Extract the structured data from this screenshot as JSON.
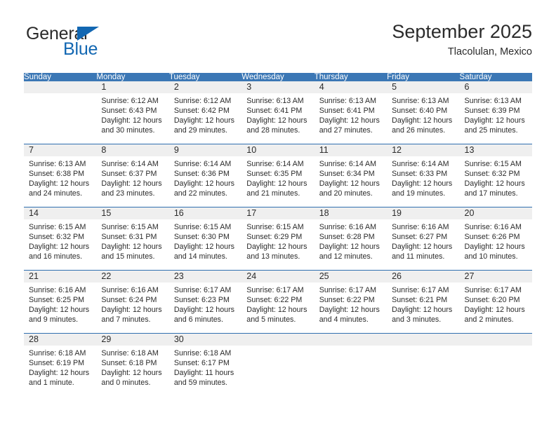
{
  "brand": {
    "name_top": "General",
    "name_bottom": "Blue",
    "accent_color": "#1267b2"
  },
  "header": {
    "title": "September 2025",
    "subtitle": "Tlacolulan, Mexico"
  },
  "theme": {
    "header_row_bg": "#3b77b5",
    "row_divider": "#2f6fb0",
    "daynum_band_bg": "#efefef",
    "text": "#2b2b2b"
  },
  "weekdays": [
    "Sunday",
    "Monday",
    "Tuesday",
    "Wednesday",
    "Thursday",
    "Friday",
    "Saturday"
  ],
  "weeks": [
    [
      {
        "day": "",
        "lines": []
      },
      {
        "day": "1",
        "lines": [
          "Sunrise: 6:12 AM",
          "Sunset: 6:43 PM",
          "Daylight: 12 hours",
          "and 30 minutes."
        ]
      },
      {
        "day": "2",
        "lines": [
          "Sunrise: 6:12 AM",
          "Sunset: 6:42 PM",
          "Daylight: 12 hours",
          "and 29 minutes."
        ]
      },
      {
        "day": "3",
        "lines": [
          "Sunrise: 6:13 AM",
          "Sunset: 6:41 PM",
          "Daylight: 12 hours",
          "and 28 minutes."
        ]
      },
      {
        "day": "4",
        "lines": [
          "Sunrise: 6:13 AM",
          "Sunset: 6:41 PM",
          "Daylight: 12 hours",
          "and 27 minutes."
        ]
      },
      {
        "day": "5",
        "lines": [
          "Sunrise: 6:13 AM",
          "Sunset: 6:40 PM",
          "Daylight: 12 hours",
          "and 26 minutes."
        ]
      },
      {
        "day": "6",
        "lines": [
          "Sunrise: 6:13 AM",
          "Sunset: 6:39 PM",
          "Daylight: 12 hours",
          "and 25 minutes."
        ]
      }
    ],
    [
      {
        "day": "7",
        "lines": [
          "Sunrise: 6:13 AM",
          "Sunset: 6:38 PM",
          "Daylight: 12 hours",
          "and 24 minutes."
        ]
      },
      {
        "day": "8",
        "lines": [
          "Sunrise: 6:14 AM",
          "Sunset: 6:37 PM",
          "Daylight: 12 hours",
          "and 23 minutes."
        ]
      },
      {
        "day": "9",
        "lines": [
          "Sunrise: 6:14 AM",
          "Sunset: 6:36 PM",
          "Daylight: 12 hours",
          "and 22 minutes."
        ]
      },
      {
        "day": "10",
        "lines": [
          "Sunrise: 6:14 AM",
          "Sunset: 6:35 PM",
          "Daylight: 12 hours",
          "and 21 minutes."
        ]
      },
      {
        "day": "11",
        "lines": [
          "Sunrise: 6:14 AM",
          "Sunset: 6:34 PM",
          "Daylight: 12 hours",
          "and 20 minutes."
        ]
      },
      {
        "day": "12",
        "lines": [
          "Sunrise: 6:14 AM",
          "Sunset: 6:33 PM",
          "Daylight: 12 hours",
          "and 19 minutes."
        ]
      },
      {
        "day": "13",
        "lines": [
          "Sunrise: 6:15 AM",
          "Sunset: 6:32 PM",
          "Daylight: 12 hours",
          "and 17 minutes."
        ]
      }
    ],
    [
      {
        "day": "14",
        "lines": [
          "Sunrise: 6:15 AM",
          "Sunset: 6:32 PM",
          "Daylight: 12 hours",
          "and 16 minutes."
        ]
      },
      {
        "day": "15",
        "lines": [
          "Sunrise: 6:15 AM",
          "Sunset: 6:31 PM",
          "Daylight: 12 hours",
          "and 15 minutes."
        ]
      },
      {
        "day": "16",
        "lines": [
          "Sunrise: 6:15 AM",
          "Sunset: 6:30 PM",
          "Daylight: 12 hours",
          "and 14 minutes."
        ]
      },
      {
        "day": "17",
        "lines": [
          "Sunrise: 6:15 AM",
          "Sunset: 6:29 PM",
          "Daylight: 12 hours",
          "and 13 minutes."
        ]
      },
      {
        "day": "18",
        "lines": [
          "Sunrise: 6:16 AM",
          "Sunset: 6:28 PM",
          "Daylight: 12 hours",
          "and 12 minutes."
        ]
      },
      {
        "day": "19",
        "lines": [
          "Sunrise: 6:16 AM",
          "Sunset: 6:27 PM",
          "Daylight: 12 hours",
          "and 11 minutes."
        ]
      },
      {
        "day": "20",
        "lines": [
          "Sunrise: 6:16 AM",
          "Sunset: 6:26 PM",
          "Daylight: 12 hours",
          "and 10 minutes."
        ]
      }
    ],
    [
      {
        "day": "21",
        "lines": [
          "Sunrise: 6:16 AM",
          "Sunset: 6:25 PM",
          "Daylight: 12 hours",
          "and 9 minutes."
        ]
      },
      {
        "day": "22",
        "lines": [
          "Sunrise: 6:16 AM",
          "Sunset: 6:24 PM",
          "Daylight: 12 hours",
          "and 7 minutes."
        ]
      },
      {
        "day": "23",
        "lines": [
          "Sunrise: 6:17 AM",
          "Sunset: 6:23 PM",
          "Daylight: 12 hours",
          "and 6 minutes."
        ]
      },
      {
        "day": "24",
        "lines": [
          "Sunrise: 6:17 AM",
          "Sunset: 6:22 PM",
          "Daylight: 12 hours",
          "and 5 minutes."
        ]
      },
      {
        "day": "25",
        "lines": [
          "Sunrise: 6:17 AM",
          "Sunset: 6:22 PM",
          "Daylight: 12 hours",
          "and 4 minutes."
        ]
      },
      {
        "day": "26",
        "lines": [
          "Sunrise: 6:17 AM",
          "Sunset: 6:21 PM",
          "Daylight: 12 hours",
          "and 3 minutes."
        ]
      },
      {
        "day": "27",
        "lines": [
          "Sunrise: 6:17 AM",
          "Sunset: 6:20 PM",
          "Daylight: 12 hours",
          "and 2 minutes."
        ]
      }
    ],
    [
      {
        "day": "28",
        "lines": [
          "Sunrise: 6:18 AM",
          "Sunset: 6:19 PM",
          "Daylight: 12 hours",
          "and 1 minute."
        ]
      },
      {
        "day": "29",
        "lines": [
          "Sunrise: 6:18 AM",
          "Sunset: 6:18 PM",
          "Daylight: 12 hours",
          "and 0 minutes."
        ]
      },
      {
        "day": "30",
        "lines": [
          "Sunrise: 6:18 AM",
          "Sunset: 6:17 PM",
          "Daylight: 11 hours",
          "and 59 minutes."
        ]
      },
      {
        "day": "",
        "lines": []
      },
      {
        "day": "",
        "lines": []
      },
      {
        "day": "",
        "lines": []
      },
      {
        "day": "",
        "lines": []
      }
    ]
  ]
}
